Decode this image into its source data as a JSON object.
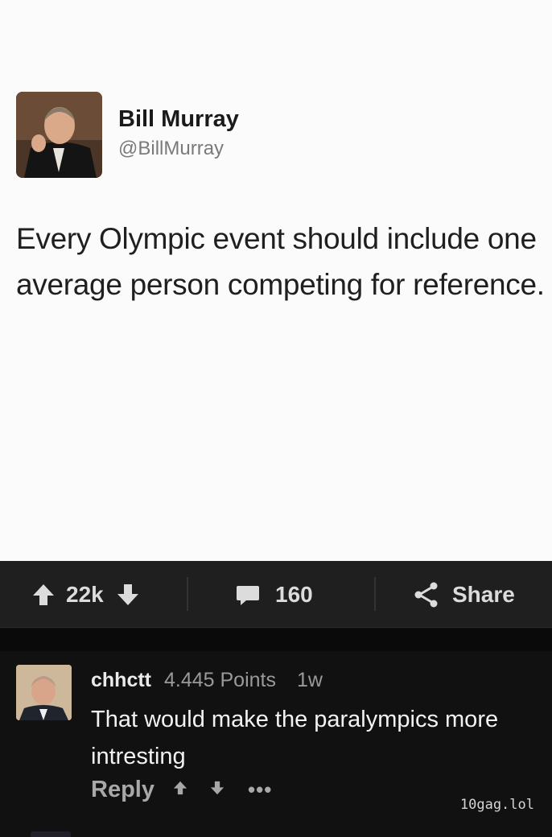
{
  "tweet": {
    "author_name": "Bill Murray",
    "author_handle": "@BillMurray",
    "text": "Every Olympic event should include one average person competing for reference."
  },
  "action_bar": {
    "votes": "22k",
    "comments": "160",
    "share_label": "Share",
    "icons": [
      "arrow-up-icon",
      "arrow-down-icon",
      "comment-bubble-icon",
      "share-icon"
    ]
  },
  "comment": {
    "username": "chhctt",
    "points": "4.445 Points",
    "time": "1w",
    "text": "That would make the paralympics more intresting",
    "reply_label": "Reply",
    "more_label": "•••"
  },
  "watermark": "10gag.lol",
  "colors": {
    "tweet_bg": "#fbfbfb",
    "bar_bg": "#1f1f1f",
    "page_bg": "#111111",
    "accent_text": "#dcdcdc"
  }
}
